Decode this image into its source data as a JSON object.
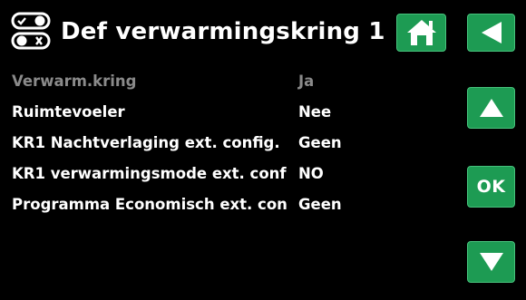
{
  "header": {
    "title": "Def verwarmingskring 1",
    "icon": "toggle-switches-icon"
  },
  "nav": {
    "home_icon": "home-icon",
    "back_icon": "back-arrow-icon",
    "up_icon": "up-arrow-icon",
    "ok_label": "OK",
    "down_icon": "down-arrow-icon"
  },
  "settings": [
    {
      "label": "Verwarm.kring",
      "value": "Ja",
      "state": "disabled"
    },
    {
      "label": "Ruimtevoeler",
      "value": "Nee",
      "state": "enabled"
    },
    {
      "label": "KR1 Nachtverlaging ext. config.",
      "value": "Geen",
      "state": "enabled"
    },
    {
      "label": "KR1 verwarmingsmode ext. conf",
      "value": "NO",
      "state": "enabled"
    },
    {
      "label": "Programma Economisch ext. con",
      "value": "Geen",
      "state": "enabled"
    }
  ],
  "colors": {
    "background": "#000000",
    "button": "#1d9b53",
    "text": "#ffffff",
    "disabled_text": "#8a8a8a"
  }
}
